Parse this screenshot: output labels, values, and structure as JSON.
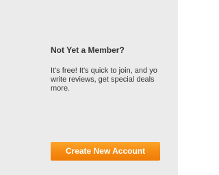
{
  "member_prompt": {
    "heading": "Not Yet a Member?",
    "body_lines": [
      "It's free! It's quick to join, and yo",
      "write reviews, get special deals",
      "more."
    ],
    "button_label": "Create New Account"
  },
  "colors": {
    "panel_background": "#ebebeb",
    "button_orange": "#f58a12",
    "text": "#333333"
  }
}
